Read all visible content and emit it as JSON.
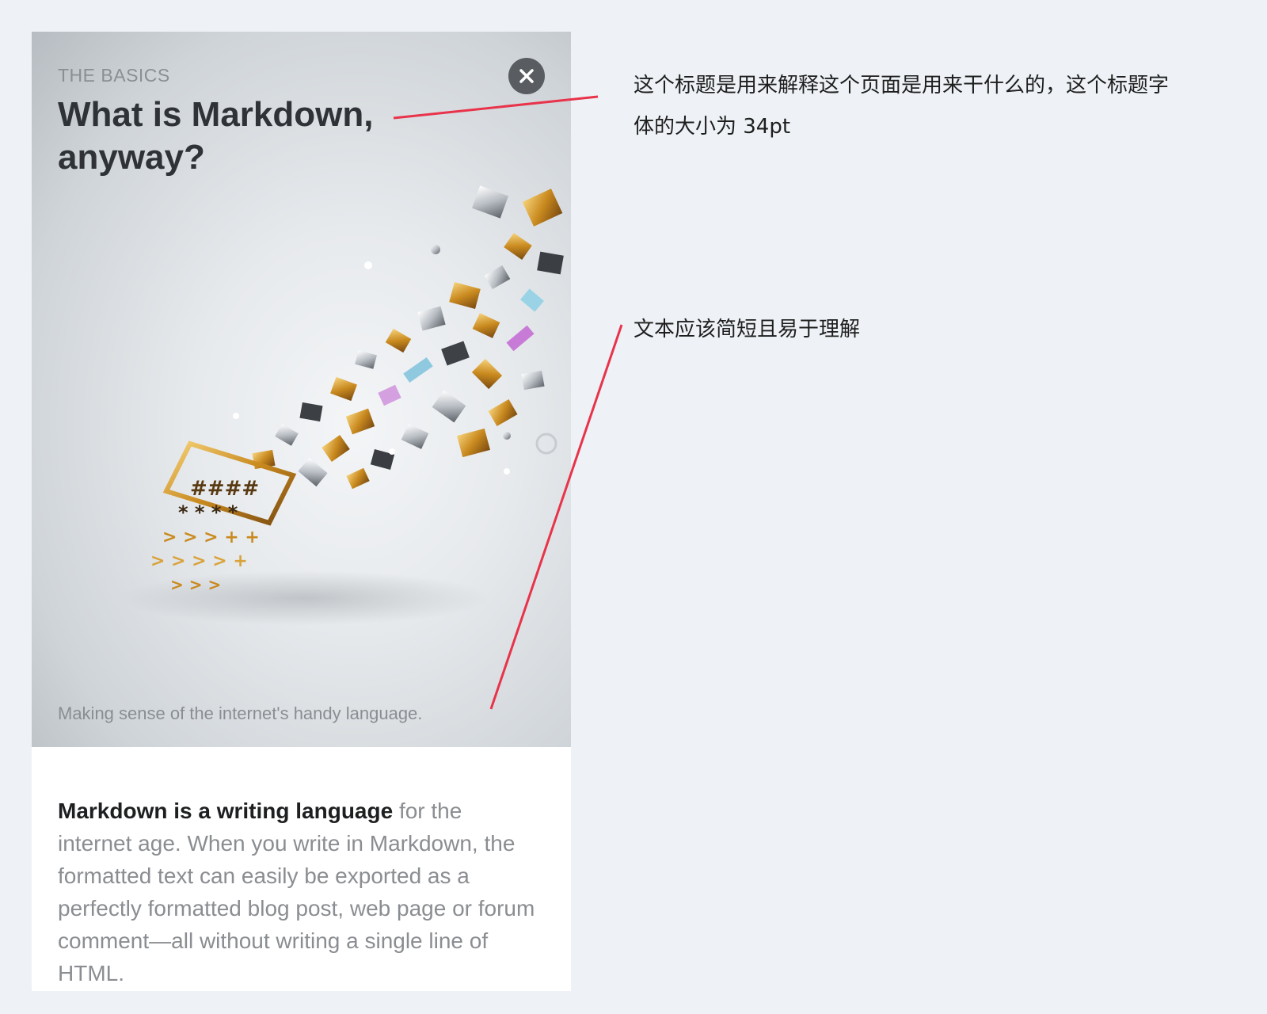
{
  "card": {
    "eyebrow": "THE BASICS",
    "headline": "What is Markdown, anyway?",
    "subtitle": "Making sense of the internet's handy language.",
    "close_icon": "close-icon",
    "body_strong": "Markdown is a writing language",
    "body_rest": " for the internet age. When you write in Markdown, the formatted text can easily be exported as a perfectly formatted blog post, web page or forum comment—all without writing a single line of HTML."
  },
  "annotations": {
    "title_note": "这个标题是用来解释这个页面是用来干什么的，这个标题字体的大小为 34pt",
    "subtitle_note": "文本应该简短且易于理解"
  },
  "colors": {
    "page_background": "#eef2f6",
    "leader_line": "#e8334a",
    "headline": "#2f3337",
    "close_button": "#595d61"
  }
}
